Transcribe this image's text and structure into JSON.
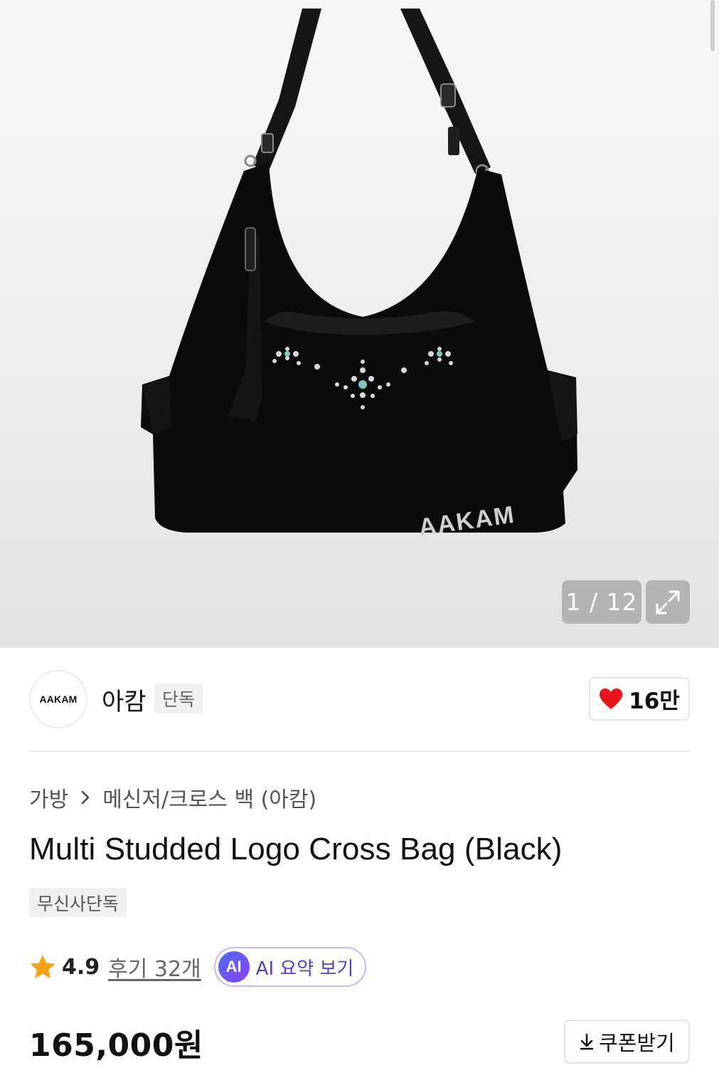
{
  "gallery": {
    "counter": "1 / 12",
    "expand_icon": "expand-icon",
    "bag_logo_text": "AAKAM"
  },
  "brand": {
    "logo_text": "AAKAM",
    "name": "아캄",
    "tag": "단독",
    "like_icon": "heart-icon",
    "like_color": "#e8131c",
    "like_count": "16만"
  },
  "breadcrumb": {
    "category": "가방",
    "subcategory": "메신저/크로스 백 (아캄)"
  },
  "product": {
    "title": "Multi Studded Logo Cross Bag (Black)",
    "exclusive_tag": "무신사단독"
  },
  "rating": {
    "star_color": "#f7a21b",
    "value": "4.9",
    "reviews_label": "후기 32개",
    "ai_badge": "AI",
    "ai_summary_label": "AI 요약 보기"
  },
  "purchase": {
    "price": "165,000원",
    "coupon_label": "쿠폰받기",
    "coupon_icon": "download-icon"
  }
}
